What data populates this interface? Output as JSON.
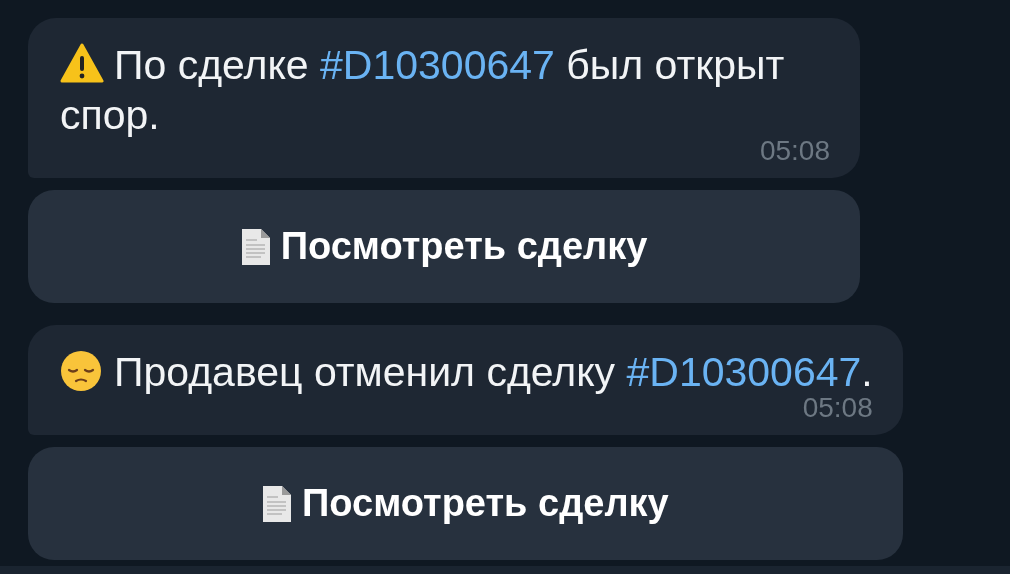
{
  "messages": [
    {
      "kind": "warning",
      "text_before": "По сделке ",
      "hashtag": "#D10300647",
      "text_after": " был открыт спор.",
      "time": "05:08",
      "button": {
        "label": "Посмотреть сделку"
      }
    },
    {
      "kind": "sad",
      "text_before": "Продавец отменил сделку ",
      "hashtag": "#D10300647",
      "text_after": ".",
      "time": "05:08",
      "button": {
        "label": "Посмотреть сделку"
      }
    }
  ]
}
